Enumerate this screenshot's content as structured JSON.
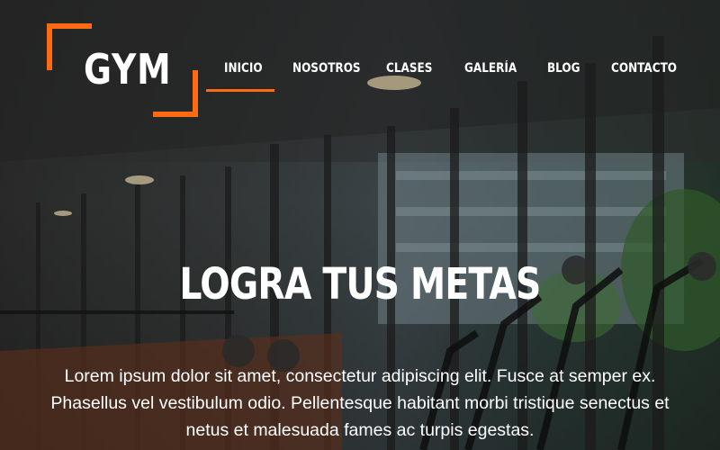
{
  "brand": {
    "logo_text": "GYM",
    "accent_color": "#ff6a13"
  },
  "nav": {
    "items": [
      {
        "label": "INICIO",
        "active": true
      },
      {
        "label": "NOSOTROS",
        "active": false
      },
      {
        "label": "CLASES",
        "active": false
      },
      {
        "label": "GALERÍA",
        "active": false
      },
      {
        "label": "BLOG",
        "active": false
      },
      {
        "label": "CONTACTO",
        "active": false
      }
    ]
  },
  "hero": {
    "title": "LOGRA TUS METAS",
    "text": "Lorem ipsum dolor sit amet, consectetur adipiscing elit. Fusce at semper ex. Phasellus vel vestibulum odio. Pellentesque habitant morbi tristique senectus et netus et malesuada fames ac turpis egestas."
  }
}
